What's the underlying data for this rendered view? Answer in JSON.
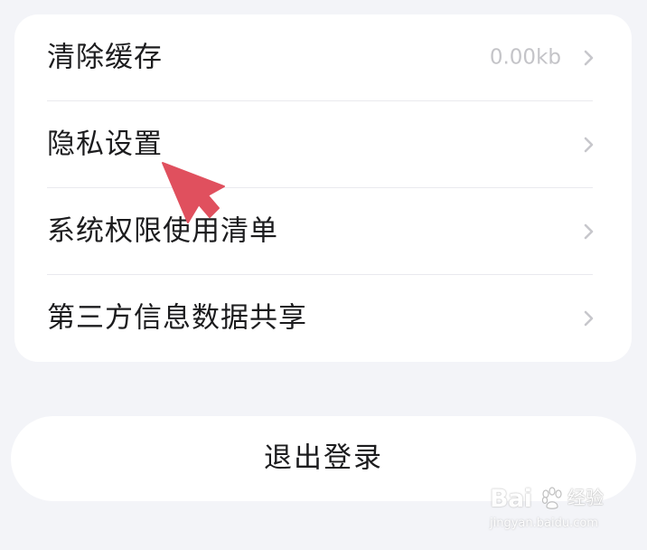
{
  "settings": {
    "items": [
      {
        "label": "清除缓存",
        "value": "0.00kb"
      },
      {
        "label": "隐私设置"
      },
      {
        "label": "系统权限使用清单"
      },
      {
        "label": "第三方信息数据共享"
      }
    ]
  },
  "logout": {
    "label": "退出登录"
  },
  "watermark": {
    "brand": "Bai",
    "product": "经验",
    "url": "jingyan.baidu.com"
  },
  "colors": {
    "background": "#f3f4f8",
    "card": "#ffffff",
    "value_text": "#c4c4c8",
    "chevron": "#c7c7cc",
    "annotation_arrow": "#e0505e"
  },
  "icons": {
    "chevron": "chevron-right-icon",
    "arrow": "annotation-arrow-icon",
    "paw": "baidu-paw-icon"
  }
}
